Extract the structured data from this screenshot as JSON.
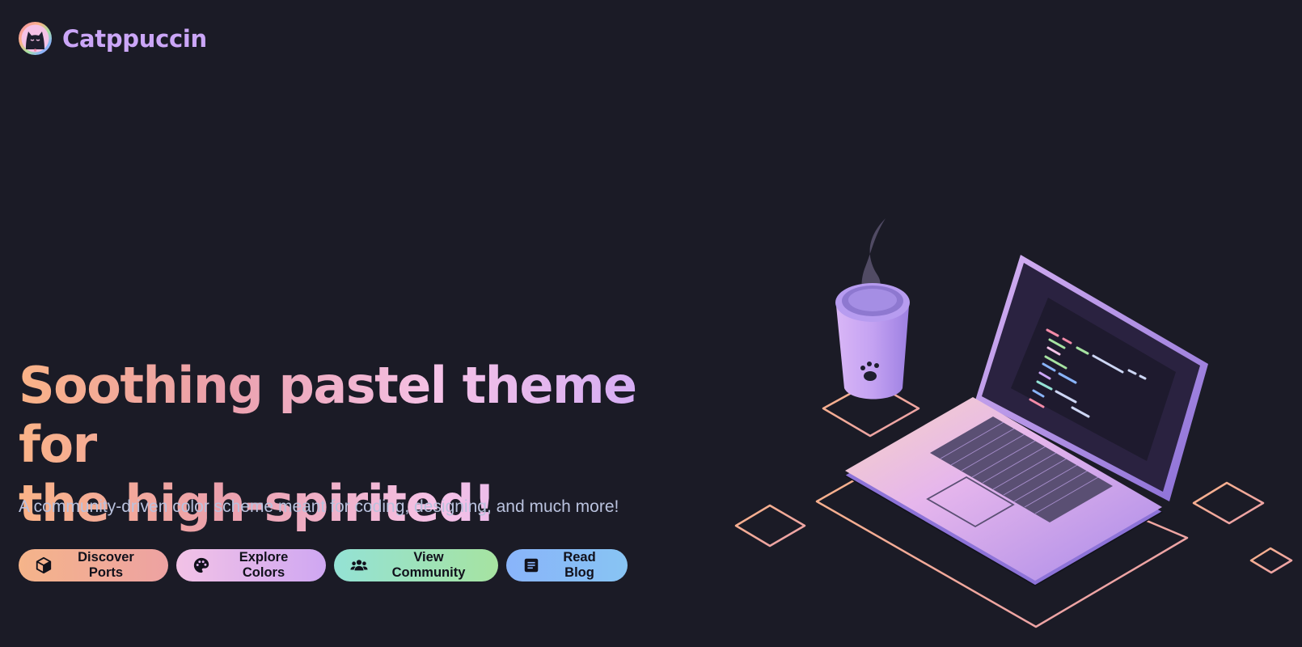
{
  "brand": {
    "name": "Catppuccin",
    "logo_icon": "catppuccin-cat-logo"
  },
  "hero": {
    "title_line1": "Soothing pastel theme for",
    "title_line2": "the high-spirited!",
    "subtitle": "A community-driven color scheme meant for coding, designing, and much more!"
  },
  "actions": [
    {
      "label": "Discover Ports",
      "icon": "package-icon",
      "color": "#fab387"
    },
    {
      "label": "Explore Colors",
      "icon": "palette-icon",
      "color": "#cba6f7"
    },
    {
      "label": "View Community",
      "icon": "people-icon",
      "color": "#94e2d5"
    },
    {
      "label": "Read Blog",
      "icon": "article-icon",
      "color": "#89b4fa"
    }
  ],
  "colors": {
    "background": "#1b1b26",
    "peach": "#fab387",
    "mauve": "#cba6f7",
    "pink": "#f5c2e7",
    "subtext": "#bac2de"
  }
}
